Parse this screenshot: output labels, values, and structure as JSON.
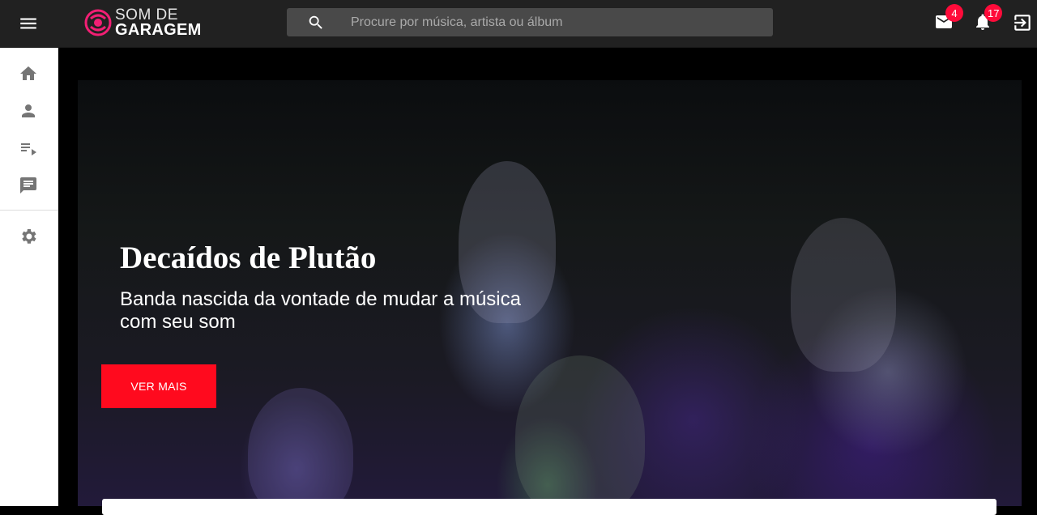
{
  "header": {
    "logo": {
      "line1": "SOM DE",
      "line2": "GARAGEM",
      "mark_color": "#f21f74"
    },
    "search": {
      "placeholder": "Procure por música, artista ou álbum",
      "value": ""
    },
    "messages": {
      "icon": "mail-icon",
      "count": "4"
    },
    "notifications": {
      "icon": "bell-icon",
      "count": "17"
    },
    "logout": {
      "icon": "logout-icon"
    },
    "menu": {
      "icon": "menu-icon"
    }
  },
  "sidebar": {
    "items": [
      {
        "name": "home",
        "icon": "home-icon"
      },
      {
        "name": "profile",
        "icon": "person-icon"
      },
      {
        "name": "playlists",
        "icon": "playlist-icon"
      },
      {
        "name": "messages",
        "icon": "chat-icon"
      },
      {
        "name": "settings",
        "icon": "gear-icon"
      }
    ]
  },
  "hero": {
    "title": "Decaídos de Plutão",
    "subtitle": "Banda nascida da vontade de mudar a música com seu som",
    "button_label": "VER MAIS",
    "button_color": "#ff0a1e"
  },
  "colors": {
    "topbar": "#212121",
    "badge": "#ff0b3a",
    "accent": "#ff0a1e"
  }
}
